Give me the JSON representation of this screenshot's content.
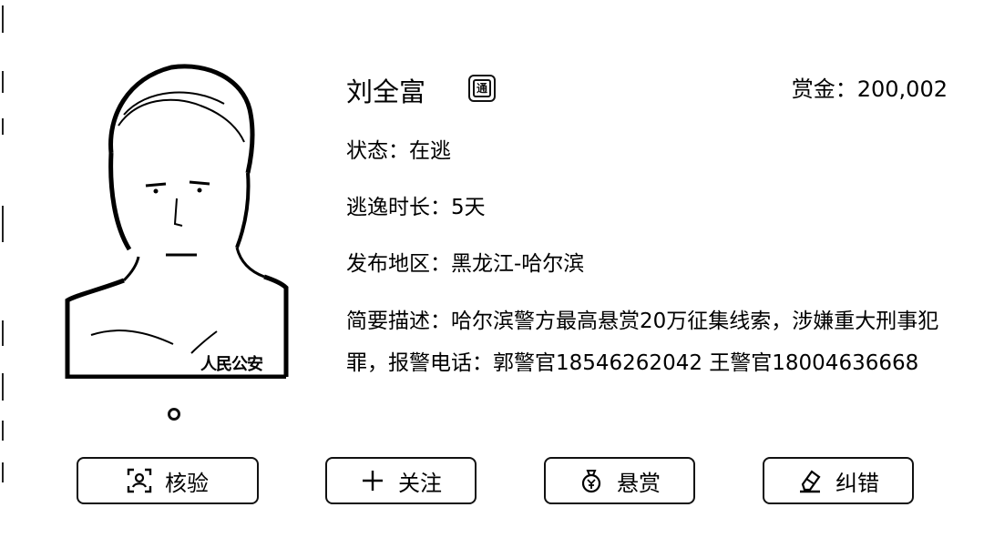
{
  "profile": {
    "name": "刘全富",
    "badge_icon": "police-badge-icon",
    "badge_text": "通",
    "bounty": "赏金：200,002",
    "photo_watermark": "人民公安"
  },
  "details": {
    "status": "状态：在逃",
    "duration": "逃逸时长：5天",
    "region": "发布地区：黑龙江-哈尔滨",
    "description": "简要描述：哈尔滨警方最高悬赏20万征集线索，涉嫌重大刑事犯罪，报警电话：郭警官18546262042 王警官18004636668"
  },
  "actions": [
    {
      "label": "核验",
      "icon": "face-verify-icon"
    },
    {
      "label": "关注",
      "icon": "plus-icon"
    },
    {
      "label": "悬赏",
      "icon": "money-bag-icon"
    },
    {
      "label": "纠错",
      "icon": "eraser-icon"
    }
  ]
}
